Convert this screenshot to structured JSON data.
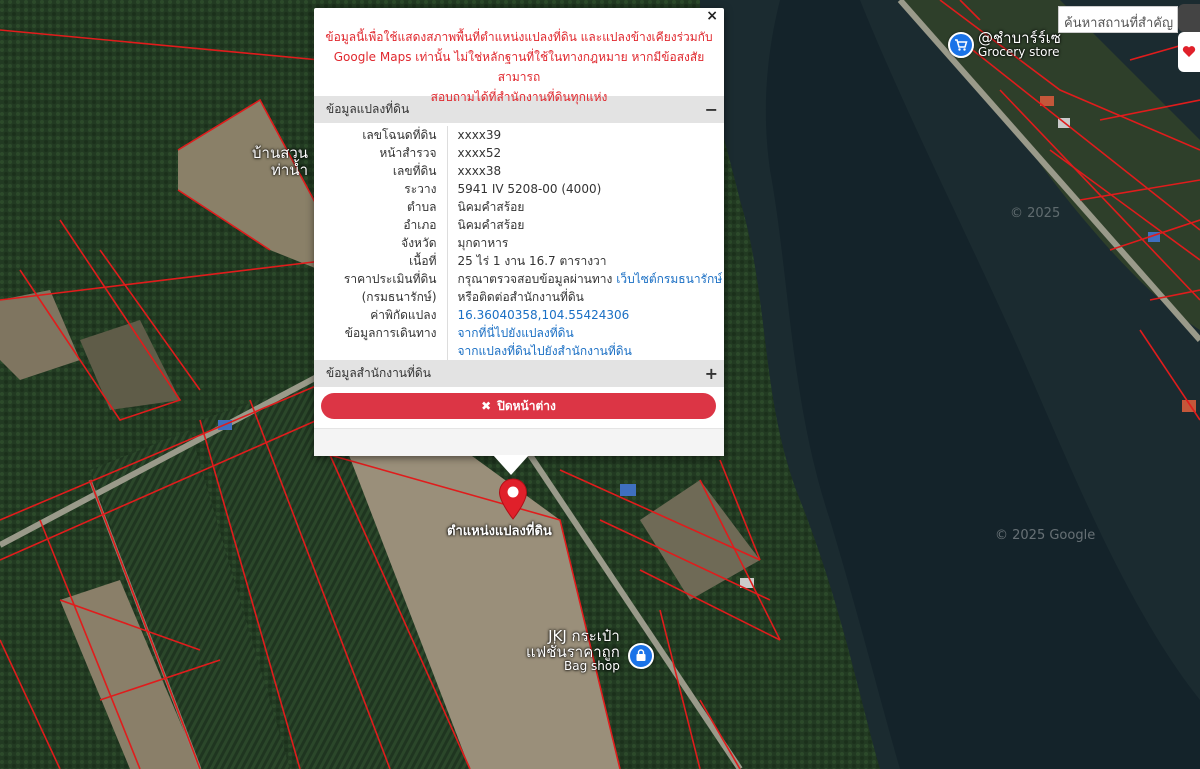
{
  "map": {
    "village_label_line1": "บ้านสวน",
    "village_label_line2": "ท่าน้ำ",
    "watermark": "© 2025 Google",
    "watermark_partial": "© 2025"
  },
  "search": {
    "placeholder": "ค้นหาสถานที่สำคัญ"
  },
  "pois": {
    "grocery": {
      "name": "@ชำบาร์ร์เซ",
      "category": "Grocery store",
      "icon": "shopping-cart-icon"
    },
    "bagshop": {
      "name_line1": "JKJ กระเป๋า",
      "name_line2": "แฟชั่นราคาถูก",
      "category": "Bag shop",
      "icon": "bag-icon"
    }
  },
  "marker": {
    "label": "ตำแหน่งแปลงที่ดิน",
    "icon": "map-pin-icon",
    "color": "#e0202a"
  },
  "popup": {
    "close_symbol": "×",
    "disclaimer_line1": "ข้อมูลนี้เพื่อใช้แสดงสภาพพื้นที่ตำแหน่งแปลงที่ดิน และแปลงข้างเคียงร่วมกับ",
    "disclaimer_line2": "Google Maps เท่านั้น ไม่ใช่หลักฐานที่ใช้ในทางกฎหมาย หากมีข้อสงสัยสามารถ",
    "disclaimer_line3": "สอบถามได้ที่สำนักงานที่ดินทุกแห่ง",
    "section1_title": "ข้อมูลแปลงที่ดิน",
    "section1_toggle": "−",
    "section2_title": "ข้อมูลสำนักงานที่ดิน",
    "section2_toggle": "+",
    "rows": {
      "deed_no": {
        "label": "เลขโฉนดที่ดิน",
        "value": "xxxx39"
      },
      "survey_page": {
        "label": "หน้าสำรวจ",
        "value": "xxxx52"
      },
      "land_no": {
        "label": "เลขที่ดิน",
        "value": "xxxx38"
      },
      "sheet": {
        "label": "ระวาง",
        "value": "5941 IV 5208-00 (4000)"
      },
      "subdistrict": {
        "label": "ตำบล",
        "value": "นิคมคำสร้อย"
      },
      "district": {
        "label": "อำเภอ",
        "value": "นิคมคำสร้อย"
      },
      "province": {
        "label": "จังหวัด",
        "value": "มุกดาหาร"
      },
      "area": {
        "label": "เนื้อที่",
        "value": "25 ไร่ 1 งาน 16.7 ตารางวา"
      },
      "price": {
        "label_line1": "ราคาประเมินที่ดิน",
        "label_line2": "(กรมธนารักษ์)",
        "value_text": "กรุณาตรวจสอบข้อมูลผ่านทาง",
        "value_link": "เว็บไซต์กรมธนารักษ์",
        "value_line2": "หรือติดต่อสำนักงานที่ดิน"
      },
      "coords": {
        "label": "ค่าพิกัดแปลง",
        "value": "16.36040358,104.55424306"
      },
      "directions": {
        "label": "ข้อมูลการเดินทาง",
        "link1": "จากที่นี่ไปยังแปลงที่ดิน",
        "link2": "จากแปลงที่ดินไปยังสำนักงานที่ดิน"
      }
    },
    "close_button_icon": "✖",
    "close_button_label": "ปิดหน้าต่าง"
  }
}
